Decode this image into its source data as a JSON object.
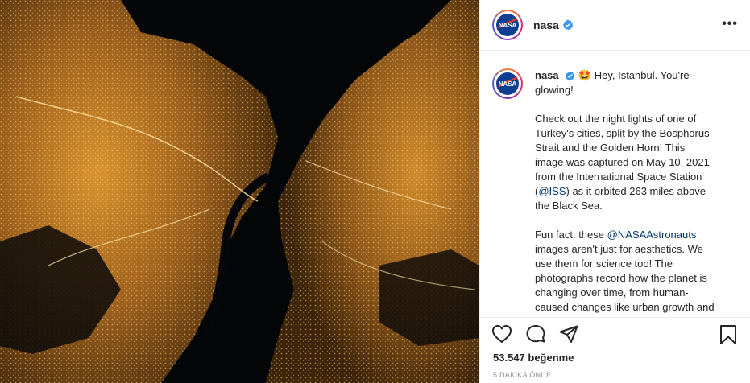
{
  "post": {
    "username": "nasa",
    "verified": true,
    "more_icon": "•••",
    "caption": {
      "username": "nasa",
      "emoji": "🤩",
      "line1": "Hey, Istanbul. You're glowing!",
      "para2_before": "Check out the night lights of one of Turkey's cities, split by the Bosphorus Strait and the Golden Horn! This image was captured on May 10, 2021 from the International Space Station (",
      "para2_mention": "@ISS",
      "para2_after": ") as it orbited 263 miles above the Black Sea.",
      "para3_before": "Fun fact: these ",
      "para3_mention": "@NASAAstronauts",
      "para3_after": " images aren't just for aesthetics. We use them for science too! The photographs record how the planet is changing over time, from human-caused changes like urban growth and"
    },
    "likes": "53.547 beğenme",
    "time": "5 DAKİKA ÖNCE"
  },
  "icons": {
    "like": "heart-icon",
    "comment": "comment-icon",
    "share": "share-icon",
    "save": "bookmark-icon",
    "verified": "verified-badge-icon"
  },
  "colors": {
    "mention": "#00376b",
    "verified": "#3897f0",
    "city_lights": "#c8862a"
  }
}
